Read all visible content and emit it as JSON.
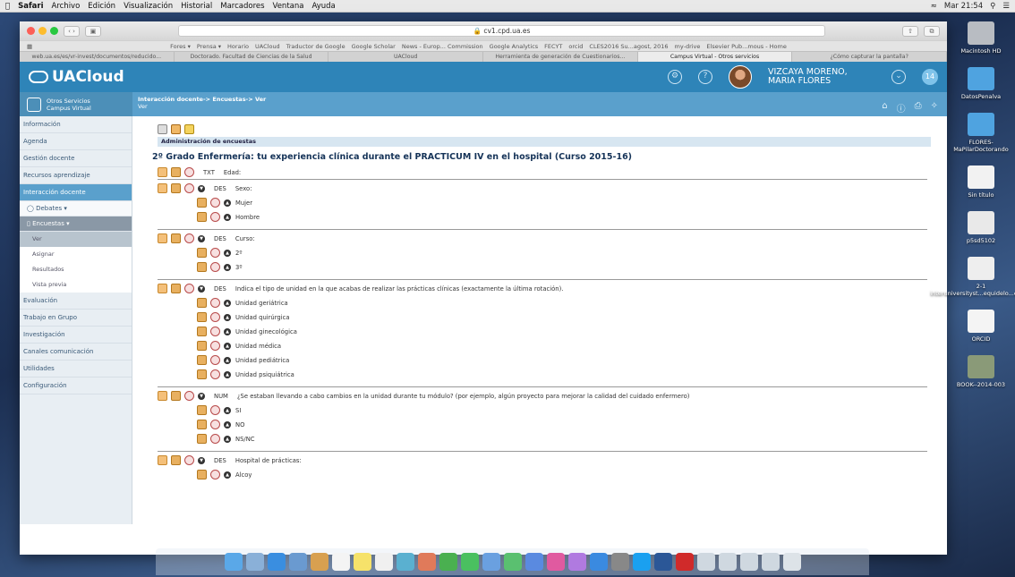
{
  "menubar": {
    "apple": "",
    "items": [
      "Safari",
      "Archivo",
      "Edición",
      "Visualización",
      "Historial",
      "Marcadores",
      "Ventana",
      "Ayuda"
    ],
    "clock": "Mar 21:54"
  },
  "browser": {
    "url": "cv1.cpd.ua.es",
    "bookmarks": [
      "Fores ▾",
      "Prensa ▾",
      "Horario",
      "UACloud",
      "Traductor de Google",
      "Google Scholar",
      "News - Europ... Commission",
      "Google Analytics",
      "FECYT",
      "orcid",
      "CLES2016 Su...agost, 2016",
      "my-drive",
      "Elsevier Pub...mous - Home"
    ],
    "tabs": [
      "web.ua.es/es/vr-invest/documentos/reducido...",
      "Doctorado. Facultad de Ciencias de la Salud",
      "UACloud",
      "Herramienta de generación de Cuestionarios...",
      "Campus Virtual - Otros servicios",
      "¿Cómo capturar la pantalla?"
    ],
    "active_tab": 4
  },
  "header": {
    "brand": "UACloud",
    "user_name": "VIZCAYA MORENO, MARIA FLORES",
    "notif_count": "14"
  },
  "subheader": {
    "otros_label_1": "Otros Servicios",
    "otros_label_2": "Campus Virtual",
    "breadcrumb": "Interacción docente-> Encuestas-> Ver",
    "page": "Ver"
  },
  "sidebar": {
    "items": [
      "Información",
      "Agenda",
      "Gestión docente",
      "Recursos aprendizaje",
      "Interacción docente"
    ],
    "debates": "Debates ▾",
    "encuestas": "Encuestas ▾",
    "sub": [
      "Ver",
      "Asignar",
      "Resultados",
      "Vista previa"
    ],
    "items_after": [
      "Evaluación",
      "Trabajo en Grupo",
      "Investigación",
      "Canales comunicación",
      "Utilidades",
      "Configuración"
    ]
  },
  "main": {
    "admin_label": "Administración de encuestas",
    "survey_title": "2º Grado Enfermería: tu experiencia clínica durante el PRACTICUM IV en el hospital (Curso 2015-16)",
    "questions": [
      {
        "type": "TXT",
        "text": "Edad:",
        "options": []
      },
      {
        "type": "DES",
        "text": "Sexo:",
        "options": [
          "Mujer",
          "Hombre"
        ]
      },
      {
        "type": "DES",
        "text": "Curso:",
        "options": [
          "2º",
          "3º"
        ]
      },
      {
        "type": "DES",
        "text": "Indica el tipo de unidad en la que acabas de realizar las prácticas clínicas (exactamente la última rotación).",
        "options": [
          "Unidad geriátrica",
          "Unidad quirúrgica",
          "Unidad ginecológica",
          "Unidad médica",
          "Unidad pediátrica",
          "Unidad psiquiátrica"
        ]
      },
      {
        "type": "NUM",
        "text": "¿Se estaban llevando a cabo cambios en la unidad durante tu módulo? (por ejemplo, algún proyecto para mejorar la calidad del cuidado enfermero)",
        "options": [
          "SI",
          "NO",
          "NS/NC"
        ]
      },
      {
        "type": "DES",
        "text": "Hospital de prácticas:",
        "options": [
          "Alcoy"
        ]
      }
    ]
  },
  "desktop": {
    "icons": [
      "Macintosh HD",
      "DatosPenalva",
      "FLORES-MaPilarDoctorando",
      "Sin título",
      "p5sd5102",
      "2-1 interuniversityst...equidelo...exts.p",
      "ORCID",
      "BOOK--2014-003"
    ]
  }
}
